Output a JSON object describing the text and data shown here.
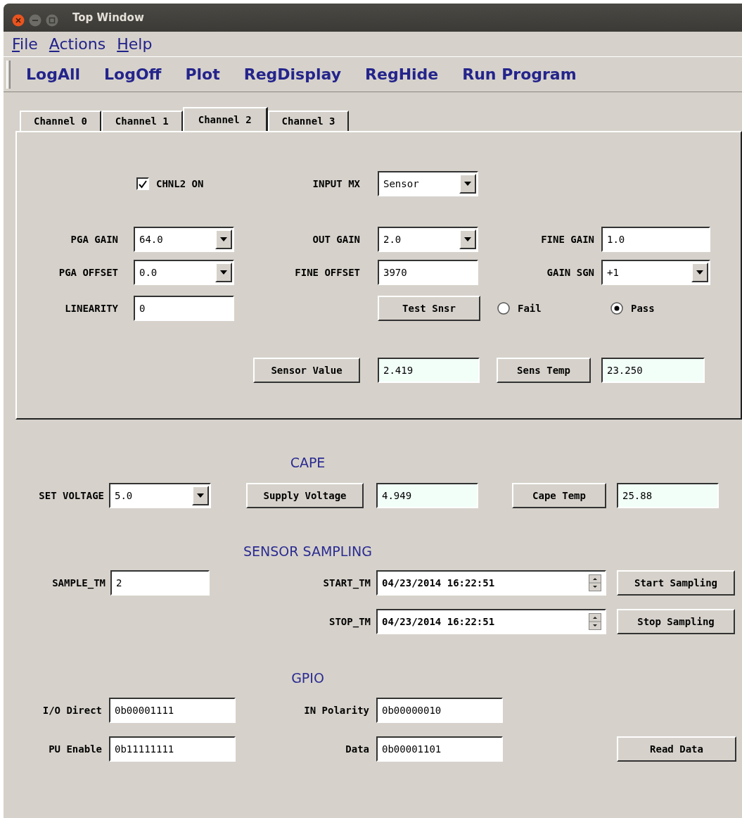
{
  "window": {
    "title": "Top Window"
  },
  "menu": [
    {
      "label": "File"
    },
    {
      "label": "Actions"
    },
    {
      "label": "Help"
    }
  ],
  "toolbar": [
    "LogAll",
    "LogOff",
    "Plot",
    "RegDisplay",
    "RegHide",
    "Run Program"
  ],
  "tabs": [
    {
      "label": "Channel 0",
      "selected": false
    },
    {
      "label": "Channel 1",
      "selected": false
    },
    {
      "label": "Channel 2",
      "selected": true
    },
    {
      "label": "Channel 3",
      "selected": false
    }
  ],
  "channel_panel": {
    "rows": [
      [
        "",
        {
          "kind": "checkbox",
          "label": "CHNL2 ON",
          "checked": true
        },
        {
          "kind": "label",
          "text": "INPUT MX"
        },
        {
          "kind": "combo",
          "value": "Sensor"
        }
      ],
      [
        {
          "kind": "label",
          "text": "PGA GAIN"
        },
        {
          "kind": "combo",
          "value": "64.0"
        },
        {
          "kind": "label",
          "text": "OUT GAIN"
        },
        {
          "kind": "combo",
          "value": "2.0"
        },
        {
          "kind": "label",
          "text": "FINE GAIN"
        },
        {
          "kind": "entry",
          "value": "1.0"
        }
      ],
      [
        {
          "kind": "label",
          "text": "PGA OFFSET"
        },
        {
          "kind": "combo",
          "value": "0.0"
        },
        {
          "kind": "label",
          "text": "FINE OFFSET"
        },
        {
          "kind": "entry",
          "value": "3970"
        },
        {
          "kind": "label",
          "text": "GAIN SGN"
        },
        {
          "kind": "combo",
          "value": "+1"
        }
      ],
      [
        {
          "kind": "label",
          "text": "LINEARITY"
        },
        {
          "kind": "entry",
          "value": "0"
        },
        "",
        {
          "kind": "button",
          "label": "Test Snsr"
        },
        {
          "kind": "radio",
          "label": "Fail",
          "selected": false
        },
        {
          "kind": "radio",
          "label": "Pass",
          "selected": true
        }
      ],
      [
        "",
        "",
        {
          "kind": "button",
          "label": "Sensor Value"
        },
        {
          "kind": "readout",
          "value": "2.419"
        },
        {
          "kind": "button",
          "label": "Sens Temp"
        },
        {
          "kind": "readout",
          "value": "23.250"
        }
      ]
    ]
  },
  "sections": [
    {
      "title": "CAPE",
      "rows": [
        [
          {
            "kind": "label",
            "text": "SET VOLTAGE"
          },
          {
            "kind": "combo",
            "value": "5.0"
          },
          {
            "kind": "button",
            "label": "Supply Voltage"
          },
          {
            "kind": "readout",
            "value": "4.949"
          },
          {
            "kind": "button",
            "label": "Cape Temp"
          },
          {
            "kind": "readout",
            "value": "25.88"
          }
        ]
      ]
    },
    {
      "title": "SENSOR SAMPLING",
      "rows": [
        [
          {
            "kind": "label",
            "text": "SAMPLE_TM"
          },
          {
            "kind": "entry",
            "value": "2"
          },
          {
            "kind": "label",
            "text": "START_TM"
          },
          {
            "kind": "spinbox",
            "value": "04/23/2014 16:22:51"
          },
          {
            "kind": "button",
            "label": "Start Sampling"
          }
        ],
        [
          "",
          "",
          {
            "kind": "label",
            "text": "STOP_TM"
          },
          {
            "kind": "spinbox",
            "value": "04/23/2014 16:22:51"
          },
          {
            "kind": "button",
            "label": "Stop Sampling"
          }
        ]
      ]
    },
    {
      "title": "GPIO",
      "rows": [
        [
          {
            "kind": "label",
            "text": "I/O Direct"
          },
          {
            "kind": "entry",
            "value": "0b00001111"
          },
          {
            "kind": "label",
            "text": "IN Polarity"
          },
          {
            "kind": "entry",
            "value": "0b00000010"
          }
        ],
        [
          {
            "kind": "label",
            "text": "PU Enable"
          },
          {
            "kind": "entry",
            "value": "0b11111111"
          },
          {
            "kind": "label",
            "text": "Data"
          },
          {
            "kind": "entry",
            "value": "0b00001101"
          },
          "",
          {
            "kind": "button",
            "label": "Read Data"
          }
        ]
      ]
    }
  ]
}
